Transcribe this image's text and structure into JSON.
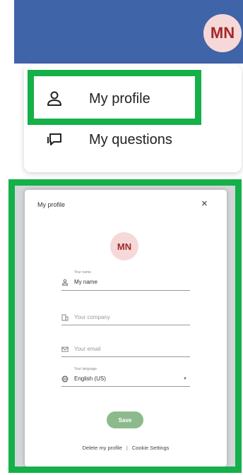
{
  "header": {
    "avatar_initials": "MN",
    "bar_color": "#3f64a8"
  },
  "menu": {
    "items": [
      {
        "label": "My profile",
        "icon": "user-icon"
      },
      {
        "label": "My questions",
        "icon": "chat-bubble-icon"
      }
    ]
  },
  "dialog": {
    "title": "My profile",
    "close_glyph": "×",
    "avatar_initials": "MN",
    "fields": {
      "name": {
        "label": "Your name",
        "value": "My name",
        "icon": "user-icon"
      },
      "company": {
        "placeholder": "Your company",
        "icon": "building-icon"
      },
      "email": {
        "placeholder": "Your email",
        "icon": "envelope-icon"
      },
      "language": {
        "label": "Your language",
        "value": "English (US)",
        "icon": "globe-icon"
      }
    },
    "save_label": "Save",
    "delete_label": "Delete my profile",
    "separator": "|",
    "cookie_label": "Cookie Settings"
  },
  "colors": {
    "highlight": "#14b048",
    "avatar_bg": "#f6d8d8",
    "avatar_text": "#a32929",
    "save_button": "#8dba8d"
  }
}
